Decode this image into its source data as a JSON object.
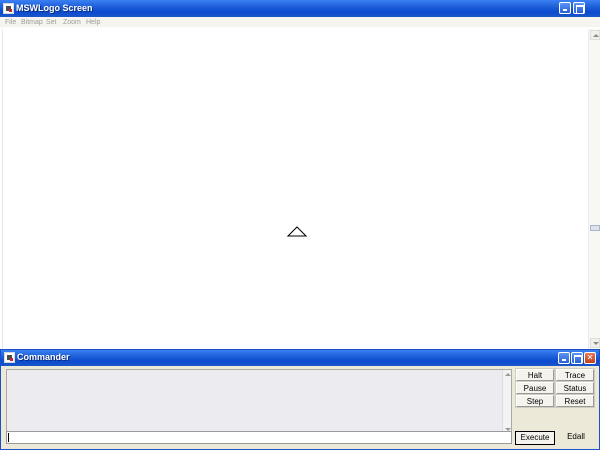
{
  "main_window": {
    "title": "MSWLogo Screen",
    "menu": [
      "File",
      "Bitmap",
      "Set",
      "Zoom",
      "Help"
    ]
  },
  "canvas": {
    "turtle_icon": "triangle-turtle-icon"
  },
  "commander": {
    "title": "Commander",
    "buttons": {
      "halt": "Halt",
      "trace": "Trace",
      "pause": "Pause",
      "status": "Status",
      "step": "Step",
      "reset": "Reset",
      "execute": "Execute",
      "edall": "Edall"
    },
    "input_value": ""
  },
  "colors": {
    "titlebar": "#0b4bd0",
    "menubar": "#f5f4ee",
    "panel": "#ece9d8"
  }
}
